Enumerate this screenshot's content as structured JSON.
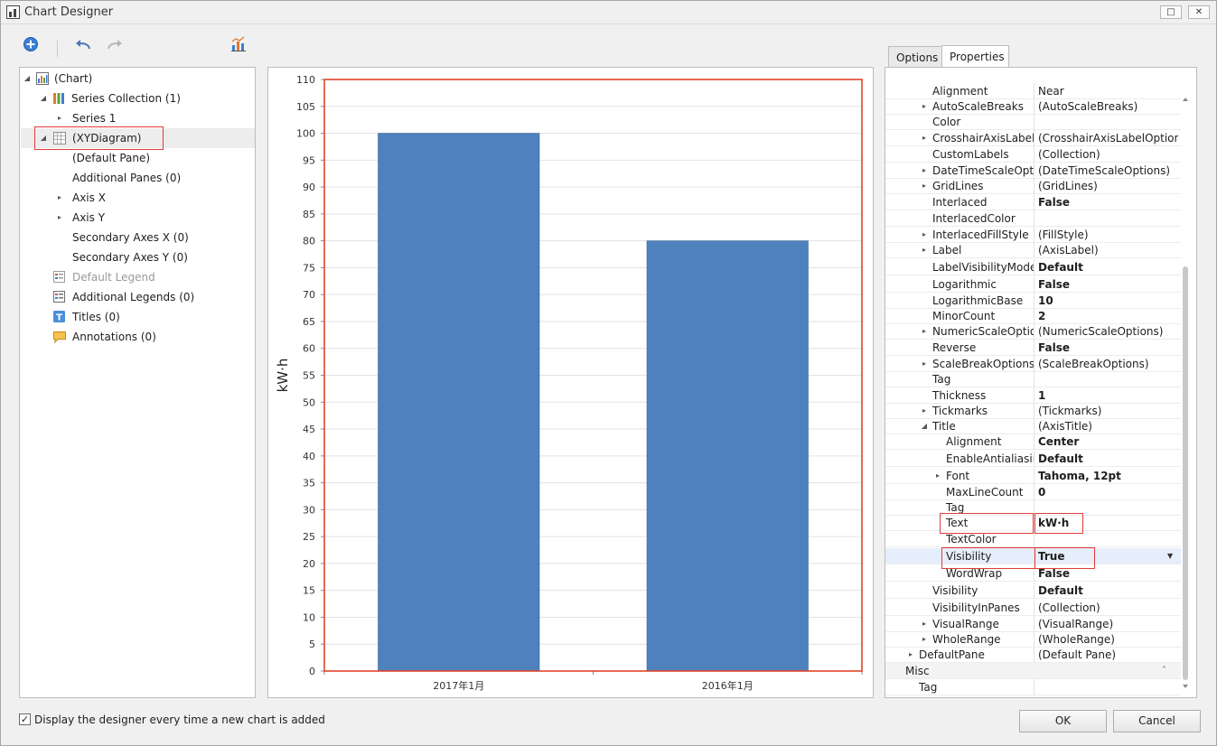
{
  "window": {
    "title": "Chart Designer"
  },
  "tree": {
    "items": [
      {
        "label": "(Chart)"
      },
      {
        "label": "Series Collection (1)"
      },
      {
        "label": "Series 1"
      },
      {
        "label": "(XYDiagram)"
      },
      {
        "label": "(Default Pane)"
      },
      {
        "label": "Additional Panes (0)"
      },
      {
        "label": "Axis X"
      },
      {
        "label": "Axis Y"
      },
      {
        "label": "Secondary Axes X (0)"
      },
      {
        "label": "Secondary Axes Y (0)"
      },
      {
        "label": "Default Legend"
      },
      {
        "label": "Additional Legends (0)"
      },
      {
        "label": "Titles (0)"
      },
      {
        "label": "Annotations (0)"
      }
    ]
  },
  "chart_data": {
    "type": "bar",
    "categories": [
      "2017年1月",
      "2016年1月"
    ],
    "series": [
      {
        "values": [
          100,
          80
        ],
        "color": "#4f81bd"
      }
    ],
    "ylabel": "kW·h",
    "ylim": [
      0,
      110
    ],
    "ytick_step": 5,
    "grid": true,
    "border_color": "#e0442a"
  },
  "tabs": [
    {
      "label": "Options"
    },
    {
      "label": "Properties"
    }
  ],
  "properties": {
    "rows": [
      {
        "name": "Alignment",
        "value": "Near"
      },
      {
        "name": "AutoScaleBreaks",
        "value": "(AutoScaleBreaks)"
      },
      {
        "name": "Color",
        "value": ""
      },
      {
        "name": "CrosshairAxisLabelOptions",
        "value": "(CrosshairAxisLabelOptions)"
      },
      {
        "name": "CustomLabels",
        "value": "(Collection)"
      },
      {
        "name": "DateTimeScaleOptions",
        "value": "(DateTimeScaleOptions)"
      },
      {
        "name": "GridLines",
        "value": "(GridLines)"
      },
      {
        "name": "Interlaced",
        "value": "False"
      },
      {
        "name": "InterlacedColor",
        "value": ""
      },
      {
        "name": "InterlacedFillStyle",
        "value": "(FillStyle)"
      },
      {
        "name": "Label",
        "value": "(AxisLabel)"
      },
      {
        "name": "LabelVisibilityMode",
        "value": "Default"
      },
      {
        "name": "Logarithmic",
        "value": "False"
      },
      {
        "name": "LogarithmicBase",
        "value": "10"
      },
      {
        "name": "MinorCount",
        "value": "2"
      },
      {
        "name": "NumericScaleOptions",
        "value": "(NumericScaleOptions)"
      },
      {
        "name": "Reverse",
        "value": "False"
      },
      {
        "name": "ScaleBreakOptions",
        "value": "(ScaleBreakOptions)"
      },
      {
        "name": "Tag",
        "value": ""
      },
      {
        "name": "Thickness",
        "value": "1"
      },
      {
        "name": "Tickmarks",
        "value": "(Tickmarks)"
      },
      {
        "name": "Title",
        "value": "(AxisTitle)"
      },
      {
        "name": "Alignment",
        "value": "Center"
      },
      {
        "name": "EnableAntialiasing",
        "value": "Default"
      },
      {
        "name": "Font",
        "value": "Tahoma, 12pt"
      },
      {
        "name": "MaxLineCount",
        "value": "0"
      },
      {
        "name": "Tag",
        "value": ""
      },
      {
        "name": "Text",
        "value": "kW·h"
      },
      {
        "name": "TextColor",
        "value": ""
      },
      {
        "name": "Visibility",
        "value": "True"
      },
      {
        "name": "WordWrap",
        "value": "False"
      },
      {
        "name": "Visibility",
        "value": "Default"
      },
      {
        "name": "VisibilityInPanes",
        "value": "(Collection)"
      },
      {
        "name": "VisualRange",
        "value": "(VisualRange)"
      },
      {
        "name": "WholeRange",
        "value": "(WholeRange)"
      },
      {
        "name": "DefaultPane",
        "value": "(Default Pane)"
      },
      {
        "name": "Misc",
        "value": ""
      },
      {
        "name": "Tag",
        "value": ""
      }
    ]
  },
  "footer": {
    "checkbox_label": "Display the designer every time a new chart is added",
    "ok_label": "OK",
    "cancel_label": "Cancel"
  },
  "icons": {
    "add": "add-circle-icon",
    "undo": "undo-icon",
    "redo": "redo-icon",
    "chart_wizard": "chart-wizard-icon"
  }
}
